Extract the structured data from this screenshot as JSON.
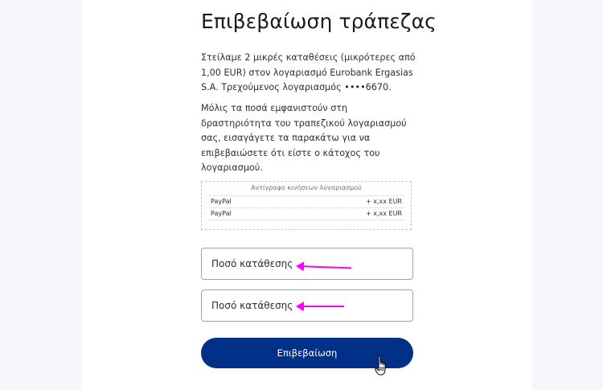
{
  "page": {
    "title": "Επιβεβαίωση τράπεζας",
    "paragraph1": "Στείλαμε 2 μικρές καταθέσεις (μικρότερες από 1,00 EUR) στον λογαριασμό Eurobank Ergasias S.A. Τρεχούμενος λογαριασμός ••••6670.",
    "paragraph2": "Μόλις τα ποσά εμφανιστούν στη δραστηριότητα του τραπεζικού λογαριασμού σας, εισαγάγετε τα παρακάτω για να επιβεβαιώσετε ότι είστε ο κάτοχος του λογαριασμού."
  },
  "statement": {
    "title": "Αντίγραφο κινήσεων λογαριασμού",
    "rows": [
      {
        "name": "PayPal",
        "amount": "+ x,xx EUR"
      },
      {
        "name": "PayPal",
        "amount": "+ x,xx EUR"
      }
    ]
  },
  "form": {
    "deposit1_placeholder": "Ποσό κατάθεσης",
    "deposit2_placeholder": "Ποσό κατάθεσης",
    "confirm_label": "Επιβεβαίωση"
  },
  "colors": {
    "button": "#003087",
    "annotation_arrow": "#ff00ff"
  }
}
